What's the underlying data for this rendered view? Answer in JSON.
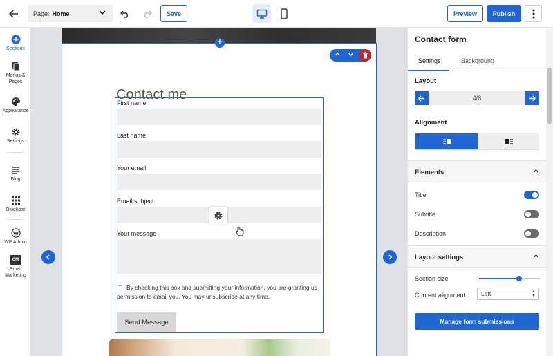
{
  "topbar": {
    "page_prefix": "Page:",
    "page_value": "Home",
    "save_label": "Save",
    "preview_label": "Preview",
    "publish_label": "Publish"
  },
  "rail": {
    "items": [
      {
        "label_lines": [
          "Sections"
        ],
        "icon": "plus-circle-icon",
        "active": true
      },
      {
        "label_lines": [
          "Menus &",
          "Pages"
        ],
        "icon": "pages-icon"
      },
      {
        "label_lines": [
          "Appearance"
        ],
        "icon": "palette-icon"
      },
      {
        "label_lines": [
          "Settings"
        ],
        "icon": "gear-icon"
      },
      {
        "label_lines": [
          "Blog"
        ],
        "icon": "blog-icon"
      },
      {
        "label_lines": [
          "Bluehost"
        ],
        "icon": "grid-icon"
      },
      {
        "label_lines": [
          "WP Admin"
        ],
        "icon": "wordpress-icon"
      },
      {
        "label_lines": [
          "Email",
          "Marketing"
        ],
        "icon": "cm-icon",
        "icon_text": "CM"
      }
    ]
  },
  "canvas": {
    "form_title": "Contact me",
    "fields": [
      {
        "label": "First name"
      },
      {
        "label": "Last name"
      },
      {
        "label": "Your email"
      },
      {
        "label": "Email subject"
      },
      {
        "label": "Your message"
      }
    ],
    "consent_text": "By checking this box and submitting your information, you are granting us permission to email you. You may unsubscribe at any time.",
    "send_label": "Send Message"
  },
  "panel": {
    "title": "Contact form",
    "tabs": [
      "Settings",
      "Background"
    ],
    "layout_heading": "Layout",
    "layout_value": "4/8",
    "alignment_heading": "Alignment",
    "elements_heading": "Elements",
    "elements": [
      {
        "label": "Title",
        "on": true
      },
      {
        "label": "Subtitle",
        "on": false
      },
      {
        "label": "Description",
        "on": false
      }
    ],
    "layout_settings_heading": "Layout settings",
    "section_size_label": "Section size",
    "section_size_value": 0.66,
    "content_alignment_label": "Content alignment",
    "content_alignment_value": "Left",
    "manage_button": "Manage form submissions"
  },
  "colors": {
    "accent": "#1e66d6",
    "danger": "#c1272d"
  }
}
